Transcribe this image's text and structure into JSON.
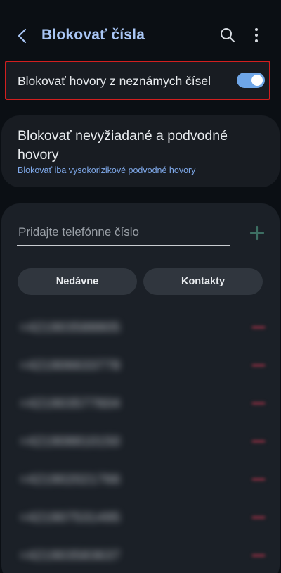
{
  "header": {
    "title": "Blokovať čísla"
  },
  "block_unknown": {
    "label": "Blokovať hovory z neznámych čísel",
    "enabled": true
  },
  "spam_block": {
    "title": "Blokovať nevyžiadané a podvodné hovory",
    "subtitle": "Blokovať iba vysokorizikové podvodné hovory"
  },
  "add_number": {
    "placeholder": "Pridajte telefónne číslo",
    "value": ""
  },
  "source_buttons": {
    "recent_label": "Nedávne",
    "contacts_label": "Kontakty"
  },
  "blocked_numbers": [
    {
      "number": "+421903588805"
    },
    {
      "number": "+421906633778"
    },
    {
      "number": "+421903577604"
    },
    {
      "number": "+421908810150"
    },
    {
      "number": "+421902021766"
    },
    {
      "number": "+421907531495"
    },
    {
      "number": "+421903583637"
    }
  ],
  "colors": {
    "accent": "#a9c6f5",
    "toggle_on": "#6fa6e8",
    "subtitle": "#7fa9ea",
    "add_icon": "#3d6f63",
    "remove_icon": "#a23246",
    "highlight_border": "#d21f1f"
  }
}
